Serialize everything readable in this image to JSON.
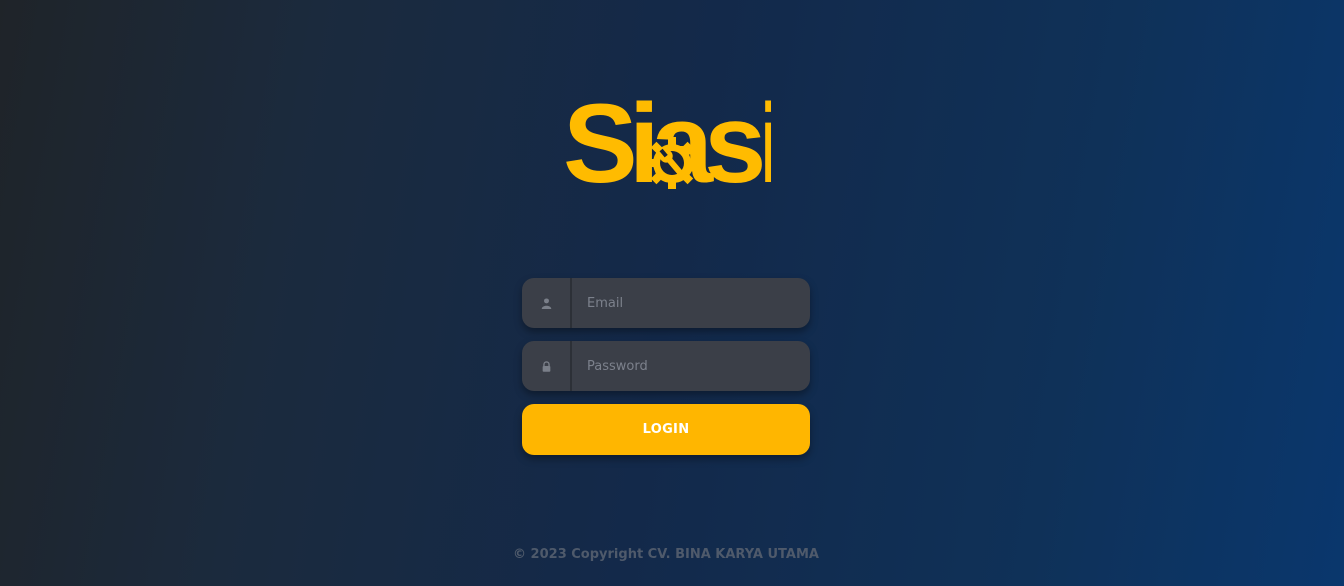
{
  "brand": {
    "logo_text": "Siasi",
    "logo_color": "#ffbb00",
    "logo_icon": "gear-wrench-icon"
  },
  "login_form": {
    "email": {
      "placeholder": "Email",
      "value": "",
      "icon": "user-icon"
    },
    "password": {
      "placeholder": "Password",
      "value": "",
      "icon": "lock-icon"
    },
    "submit_label": "LOGIN",
    "button_color": "#ffb600"
  },
  "footer": {
    "copyright": "© 2023 Copyright CV. BINA KARYA UTAMA"
  }
}
